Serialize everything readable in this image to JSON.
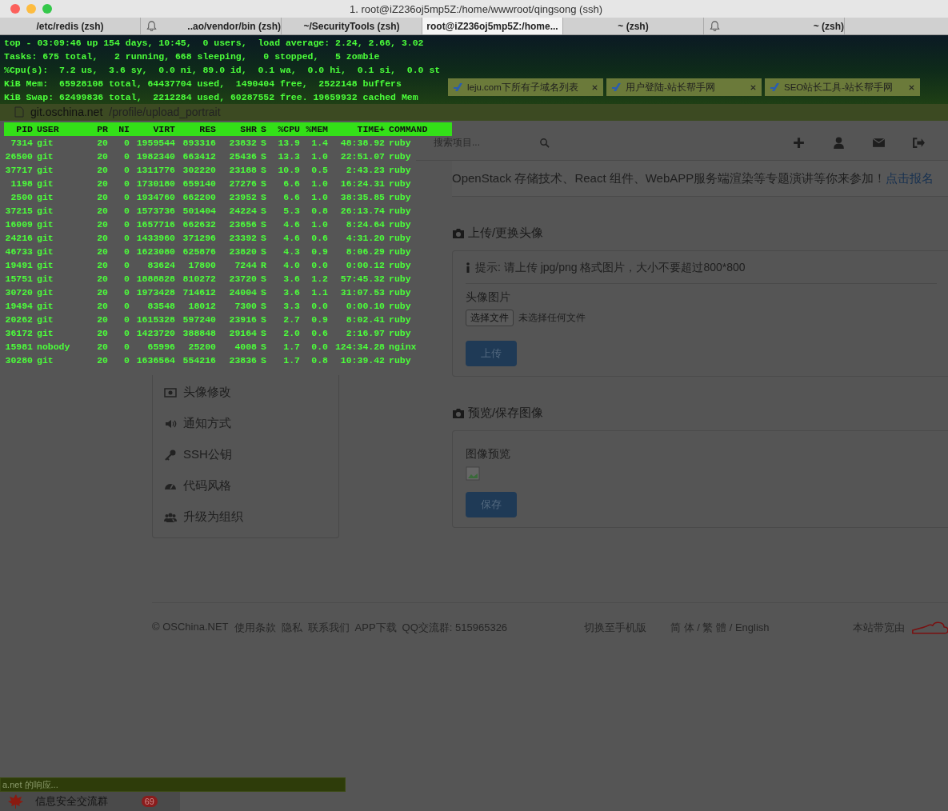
{
  "window": {
    "title": "1. root@iZ236oj5mp5Z:/home/wwwroot/qingsong (ssh)"
  },
  "terminal_tabs": [
    {
      "label": "/etc/redis (zsh)",
      "selected": false,
      "bell": false
    },
    {
      "label": "..ao/vendor/bin (zsh)",
      "selected": false,
      "bell": true
    },
    {
      "label": "~/SecurityTools (zsh)",
      "selected": false,
      "bell": false
    },
    {
      "label": "root@iZ236oj5mp5Z:/home...",
      "selected": true,
      "bell": false
    },
    {
      "label": "~ (zsh)",
      "selected": false,
      "bell": false
    },
    {
      "label": "~ (zsh)",
      "selected": false,
      "bell": true
    }
  ],
  "top_summary": [
    "top - 03:09:46 up 154 days, 10:45,  0 users,  load average: 2.24, 2.66, 3.02",
    "Tasks: 675 total,   2 running, 668 sleeping,   0 stopped,   5 zombie",
    "%Cpu(s):  7.2 us,  3.6 sy,  0.0 ni, 89.0 id,  0.1 wa,  0.0 hi,  0.1 si,  0.0 st",
    "KiB Mem:  65928108 total, 64437704 used,  1490404 free,  2522148 buffers",
    "KiB Swap: 62499836 total,  2212284 used, 60287552 free. 19659932 cached Mem"
  ],
  "browser_tabs": [
    {
      "label": "leju.com下所有子域名列表"
    },
    {
      "label": "用户登陆-站长帮手网"
    },
    {
      "label": "SEO站长工具-站长帮手网"
    }
  ],
  "address_bar": {
    "host": "git.oschina.net",
    "path": "/profile/upload_portrait"
  },
  "process_table": {
    "columns": [
      "PID",
      "USER",
      "PR",
      "NI",
      "VIRT",
      "RES",
      "SHR",
      "S",
      "%CPU",
      "%MEM",
      "TIME+",
      "COMMAND"
    ],
    "rows": [
      [
        "7314",
        "git",
        "20",
        "0",
        "1959544",
        "893316",
        "23832",
        "S",
        "13.9",
        "1.4",
        "48:38.92",
        "ruby"
      ],
      [
        "26500",
        "git",
        "20",
        "0",
        "1982340",
        "663412",
        "25436",
        "S",
        "13.3",
        "1.0",
        "22:51.07",
        "ruby"
      ],
      [
        "37717",
        "git",
        "20",
        "0",
        "1311776",
        "302220",
        "23188",
        "S",
        "10.9",
        "0.5",
        "2:43.23",
        "ruby"
      ],
      [
        "1198",
        "git",
        "20",
        "0",
        "1730180",
        "659140",
        "27276",
        "S",
        "6.6",
        "1.0",
        "16:24.31",
        "ruby"
      ],
      [
        "2500",
        "git",
        "20",
        "0",
        "1934760",
        "662200",
        "23952",
        "S",
        "6.6",
        "1.0",
        "38:35.85",
        "ruby"
      ],
      [
        "37215",
        "git",
        "20",
        "0",
        "1573736",
        "501404",
        "24224",
        "S",
        "5.3",
        "0.8",
        "26:13.74",
        "ruby"
      ],
      [
        "16009",
        "git",
        "20",
        "0",
        "1657716",
        "662632",
        "23656",
        "S",
        "4.6",
        "1.0",
        "8:24.64",
        "ruby"
      ],
      [
        "24216",
        "git",
        "20",
        "0",
        "1433960",
        "371296",
        "23392",
        "S",
        "4.6",
        "0.6",
        "4:31.20",
        "ruby"
      ],
      [
        "46733",
        "git",
        "20",
        "0",
        "1623080",
        "625876",
        "23820",
        "S",
        "4.3",
        "0.9",
        "8:06.29",
        "ruby"
      ],
      [
        "19491",
        "git",
        "20",
        "0",
        "83624",
        "17800",
        "7244",
        "R",
        "4.0",
        "0.0",
        "0:00.12",
        "ruby"
      ],
      [
        "15751",
        "git",
        "20",
        "0",
        "1888828",
        "810272",
        "23720",
        "S",
        "3.6",
        "1.2",
        "57:45.32",
        "ruby"
      ],
      [
        "30720",
        "git",
        "20",
        "0",
        "1973428",
        "714612",
        "24004",
        "S",
        "3.6",
        "1.1",
        "31:07.53",
        "ruby"
      ],
      [
        "19494",
        "git",
        "20",
        "0",
        "83548",
        "18012",
        "7300",
        "S",
        "3.3",
        "0.0",
        "0:00.10",
        "ruby"
      ],
      [
        "20262",
        "git",
        "20",
        "0",
        "1615328",
        "597240",
        "23916",
        "S",
        "2.7",
        "0.9",
        "8:02.41",
        "ruby"
      ],
      [
        "36172",
        "git",
        "20",
        "0",
        "1423720",
        "388848",
        "29164",
        "S",
        "2.0",
        "0.6",
        "2:16.97",
        "ruby"
      ],
      [
        "15981",
        "nobody",
        "20",
        "0",
        "65996",
        "25200",
        "4008",
        "S",
        "1.7",
        "0.0",
        "124:34.28",
        "nginx"
      ],
      [
        "30280",
        "git",
        "20",
        "0",
        "1636564",
        "554216",
        "23836",
        "S",
        "1.7",
        "0.8",
        "10:39.42",
        "ruby"
      ]
    ]
  },
  "site_nav": {
    "search": {
      "placeholder": "搜索项目..."
    }
  },
  "banner": {
    "text": "OpenStack 存储技术、React 组件、WebAPP服务端渲染等专题演讲等你来参加！",
    "link": "点击报名"
  },
  "sidebar": {
    "items": [
      {
        "label": "头像修改"
      },
      {
        "label": "通知方式"
      },
      {
        "label": "SSH公钥"
      },
      {
        "label": "代码风格"
      },
      {
        "label": "升级为组织"
      }
    ]
  },
  "upload_section": {
    "title": "上传/更换头像",
    "hint": "提示: 请上传 jpg/png 格式图片，大小不要超过800*800",
    "field_label": "头像图片",
    "file_button": "选择文件",
    "file_status": "未选择任何文件",
    "submit": "上传"
  },
  "preview_section": {
    "title": "预览/保存图像",
    "label": "图像预览",
    "submit": "保存"
  },
  "footer": {
    "links": [
      "© OSChina.NET",
      "使用条款",
      "隐私",
      "联系我们",
      "APP下载",
      "QQ交流群: 515965326"
    ],
    "mobile": "切换至手机版",
    "languages": "简 体 / 繁 體 / English",
    "sponsor": "本站带宽由"
  },
  "status_bar": {
    "text": "a.net 的响应..."
  },
  "taskbar": {
    "label": "信息安全交流群",
    "badge": "69"
  }
}
